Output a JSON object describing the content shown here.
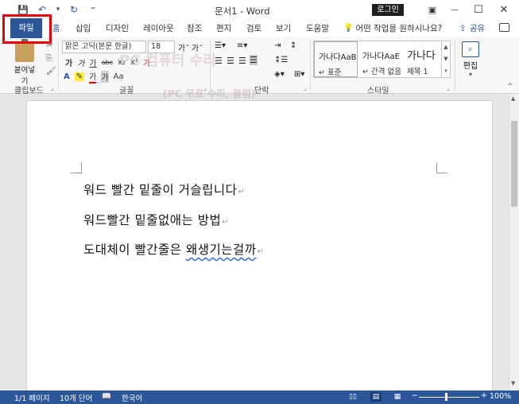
{
  "window": {
    "title": "문서1  -  Word",
    "login_label": "로그인",
    "minimize": "—",
    "maximize": "☐",
    "close": "✕",
    "ribbon_display": "▣"
  },
  "qat": {
    "save_icon": "💾",
    "undo_icon": "↶",
    "undo_dropdown": "▾",
    "redo_icon": "↻",
    "customize": "⁼"
  },
  "tabs": [
    {
      "label": "파일"
    },
    {
      "label": "홈"
    },
    {
      "label": "삽입"
    },
    {
      "label": "디자인"
    },
    {
      "label": "레이아웃"
    },
    {
      "label": "참조"
    },
    {
      "label": "편지"
    },
    {
      "label": "검토"
    },
    {
      "label": "보기"
    },
    {
      "label": "도움말"
    }
  ],
  "tell_me": "어떤 작업을 원하시나요?",
  "share_label": "공유",
  "ribbon": {
    "clipboard": {
      "paste_label": "붙여넣기",
      "group_label": "클립보드"
    },
    "font": {
      "font_name": "맑은 고딕(본문 한글)",
      "font_size": "18",
      "group_label": "글꼴",
      "row1": [
        "가",
        "가",
        "가",
        "abc",
        "x₂",
        "x²",
        "가"
      ],
      "row2": [
        "가",
        "가",
        "Aa"
      ]
    },
    "paragraph": {
      "group_label": "단락"
    },
    "styles": {
      "group_label": "스타일",
      "items": [
        {
          "sample": "가나다AaB",
          "name": "↵ 표준"
        },
        {
          "sample": "가나다AaE",
          "name": "↵ 간격 없음"
        },
        {
          "sample": "가나다",
          "name": "제목 1"
        }
      ]
    },
    "editing": {
      "label": "편집"
    }
  },
  "watermark": {
    "line1": "PC 컴퓨터 수리",
    "line2": "(PC 무료 수리, 블럼)"
  },
  "document": {
    "lines": [
      {
        "text": "워드 빨간 밑줄이 거슬립니다"
      },
      {
        "text": "워드빨간 밑줄없애는 방법"
      },
      {
        "text_plain": "도대체이 빨간줄은 ",
        "text_marked": "왜생기는걸까"
      }
    ],
    "paragraph_mark": "↵"
  },
  "status": {
    "page": "1/1 페이지",
    "words": "10개 단어",
    "language": "한국어",
    "zoom": "100%",
    "zoom_minus": "−",
    "zoom_plus": "+"
  }
}
